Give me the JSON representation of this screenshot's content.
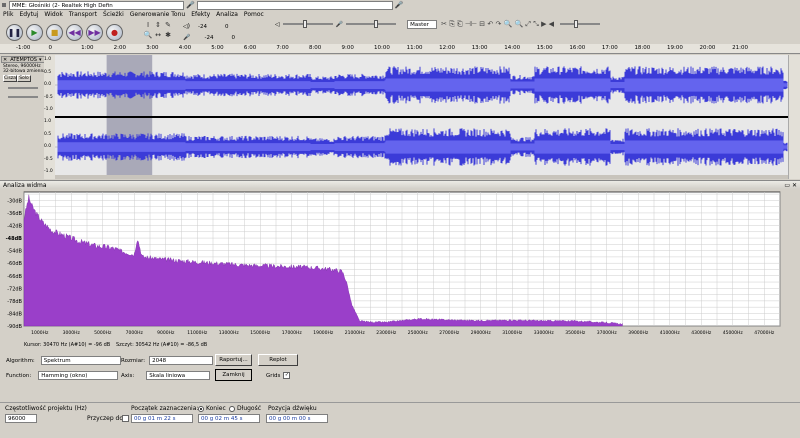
{
  "colors": {
    "bg": "#d4d0c8",
    "wave": "#3b3bd8",
    "spectrum": "#9a3fc9"
  },
  "device": {
    "host": "MME: Głośniki (2- Realtek High Defin",
    "output": ""
  },
  "menu": [
    "Plik",
    "Edytuj",
    "Widok",
    "Transport",
    "Ścieżki",
    "Generowanie Tonu",
    "Efekty",
    "Analiza",
    "Pomoc"
  ],
  "meter_channel": "Master",
  "toolbar": {
    "db1": "-24",
    "db2": "0",
    "db3": "-24",
    "db4": "0"
  },
  "timeline": {
    "labels": [
      "-1:00",
      "0",
      "1:00",
      "2:00",
      "3:00",
      "4:00",
      "5:00",
      "6:00",
      "7:00",
      "8:00",
      "9:00",
      "10:00",
      "11:00",
      "12:00",
      "13:00",
      "14:00",
      "15:00",
      "16:00",
      "17:00",
      "18:00",
      "19:00",
      "20:00",
      "21:00"
    ],
    "selection_start": 1.6,
    "selection_end": 3.0
  },
  "track": {
    "name": "ATEMPTOS",
    "info1": "Stereo, 96000Hz",
    "info2": "32-bitowa zmienna",
    "mute": "Cisza",
    "solo": "Solo",
    "scale": [
      "1.0",
      "0.5",
      "0.0",
      "-0.5",
      "-1.0"
    ]
  },
  "spectrum": {
    "title": "Analiza widma",
    "y_ticks": [
      "-30dB",
      "-36dB",
      "-42dB",
      "-48dB",
      "-54dB",
      "-60dB",
      "-66dB",
      "-72dB",
      "-78dB",
      "-84dB",
      "-90dB"
    ],
    "x_ticks": [
      "1000Hz",
      "3000Hz",
      "5000Hz",
      "7000Hz",
      "9000Hz",
      "11000Hz",
      "13000Hz",
      "15000Hz",
      "17000Hz",
      "19000Hz",
      "21000Hz",
      "23000Hz",
      "25000Hz",
      "27000Hz",
      "29000Hz",
      "31000Hz",
      "33000Hz",
      "35000Hz",
      "37000Hz",
      "39000Hz",
      "41000Hz",
      "43000Hz",
      "45000Hz",
      "47000Hz"
    ],
    "cursor": "Kursor: 30470 Hz (A#10) = -96 dB",
    "peak": "Szczyt: 30542 Hz (A#10) = -86,5 dB",
    "algorithm_label": "Algorithm:",
    "algorithm_value": "Spektrum",
    "size_label": "Rozmiar:",
    "size_value": "2048",
    "function_label": "Function:",
    "function_value": "Hamming (okno)",
    "axis_label": "Axis:",
    "axis_value": "Skala liniowa",
    "export": "Raportuj...",
    "replot": "Replot",
    "close": "Zamknij",
    "grids": "Grids"
  },
  "chart_data": {
    "type": "area",
    "title": "Analiza widma",
    "xlabel": "",
    "ylabel": "",
    "xlim": [
      0,
      48000
    ],
    "ylim": [
      -90,
      -26
    ],
    "x": [
      0,
      300,
      500,
      800,
      1200,
      1800,
      2500,
      3500,
      4500,
      5500,
      6500,
      7000,
      7200,
      7500,
      8500,
      10000,
      12000,
      14000,
      16000,
      18000,
      19500,
      20200,
      20500,
      20800,
      21300,
      22000,
      23000,
      25000,
      27000,
      29000,
      31000,
      33000,
      35000,
      37000,
      38000
    ],
    "y": [
      -40,
      -30,
      -34,
      -38,
      -42,
      -46,
      -48,
      -51,
      -53,
      -54,
      -56,
      -57,
      -49,
      -58,
      -59,
      -60,
      -61,
      -62,
      -62.5,
      -63,
      -64,
      -65,
      -70,
      -80,
      -88,
      -88.5,
      -88.6,
      -87,
      -87.5,
      -87.8,
      -87.6,
      -87.9,
      -88,
      -88.8,
      -89.5
    ]
  },
  "project": {
    "rate_label": "Częstotliwość projektu (Hz)",
    "rate": "96000",
    "snap_label": "Przyczep do",
    "sel_label": "Początek zaznaczenia:",
    "end_label": "Koniec",
    "len_label": "Długość",
    "pos_label": "Pozycja dźwięku",
    "sel_start": "00 g 01 m 22 s",
    "sel_end": "00 g 02 m 45 s",
    "pos": "00 g 00 m 00 s"
  }
}
